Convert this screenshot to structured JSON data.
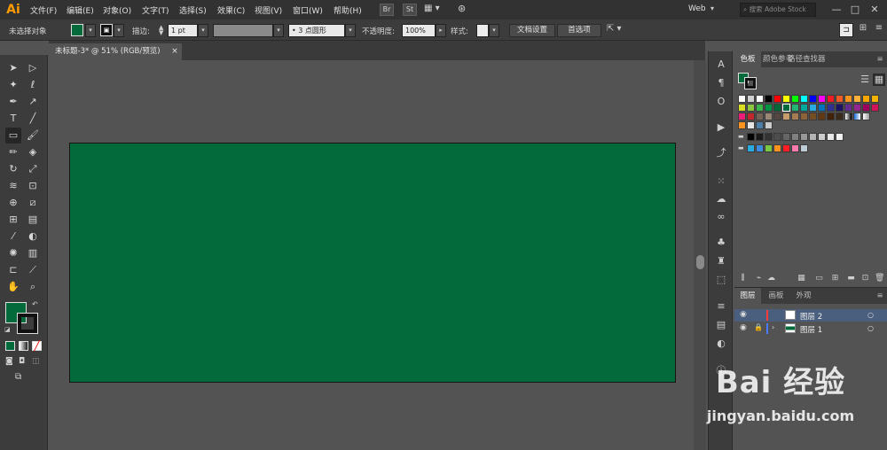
{
  "app": {
    "logo": "Ai"
  },
  "menu": [
    "文件(F)",
    "编辑(E)",
    "对象(O)",
    "文字(T)",
    "选择(S)",
    "效果(C)",
    "视图(V)",
    "窗口(W)",
    "帮助(H)"
  ],
  "menubar": {
    "br": "Br",
    "st": "St",
    "workspace": "Web",
    "search_placeholder": "搜索 Adobe Stock"
  },
  "control": {
    "selection_status": "未选择对象",
    "stroke_label": "描边:",
    "stroke_weight": "1 pt",
    "brush": "3 点圆形",
    "opacity_label": "不透明度:",
    "opacity_value": "100%",
    "style_label": "样式:",
    "doc_setup": "文档设置",
    "prefs": "首选项"
  },
  "document": {
    "tab_title": "未标题-3* @ 51% (RGB/预览)",
    "close": "×"
  },
  "swatch_panel": {
    "tabs": [
      "色板",
      "颜色参考",
      "路径查找器"
    ]
  },
  "layers_panel": {
    "tabs": [
      "图层",
      "画板",
      "外观"
    ],
    "layers": [
      {
        "name": "图层 2",
        "color": "#ff3b3b"
      },
      {
        "name": "图层 1",
        "color": "#4a7bff"
      }
    ]
  },
  "colors": {
    "fill": "#036a3c",
    "artboard": "#036a3c"
  },
  "watermark": {
    "brand": "Bai 经验",
    "url": "jingyan.baidu.com"
  }
}
